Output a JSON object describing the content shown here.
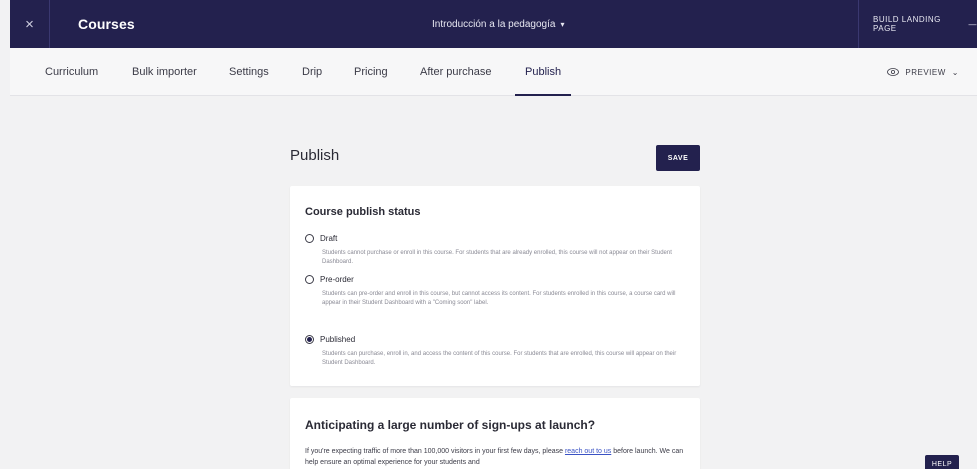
{
  "topbar": {
    "close_glyph": "×",
    "title": "Courses",
    "course_name": "Introducción a la pedagogía",
    "course_caret": "▾",
    "landing_label": "BUILD LANDING PAGE",
    "landing_dash": "—"
  },
  "tabs": [
    {
      "label": "Curriculum"
    },
    {
      "label": "Bulk importer"
    },
    {
      "label": "Settings"
    },
    {
      "label": "Drip"
    },
    {
      "label": "Pricing"
    },
    {
      "label": "After purchase"
    },
    {
      "label": "Publish",
      "active": true
    }
  ],
  "preview": {
    "label": "PREVIEW",
    "chevron": "⌄"
  },
  "main": {
    "page_title": "Publish",
    "save_label": "SAVE"
  },
  "status_card": {
    "title": "Course publish status",
    "options": [
      {
        "label": "Draft",
        "checked": false,
        "description": "Students cannot purchase or enroll in this course. For students that are already enrolled, this course will not appear on their Student Dashboard."
      },
      {
        "label": "Pre-order",
        "checked": false,
        "description": "Students can pre-order and enroll in this course, but cannot access its content. For students enrolled in this course, a course card will appear in their Student Dashboard with a \"Coming soon\" label."
      },
      {
        "label": "Published",
        "checked": true,
        "description": "Students can purchase, enroll in, and access the content of this course. For students that are enrolled, this course will appear on their Student Dashboard."
      }
    ]
  },
  "launch_card": {
    "heading": "Anticipating a large number of sign-ups at launch?",
    "body_before": "If you're expecting traffic of more than 100,000 visitors in your first few days, please ",
    "link_text": "reach out to us",
    "body_after": " before launch. We can help ensure an optimal experience for your students and"
  },
  "help_label": "HELP",
  "colors": {
    "brand": "#23214e",
    "background": "#f2f2f3",
    "link": "#3a52c4"
  }
}
